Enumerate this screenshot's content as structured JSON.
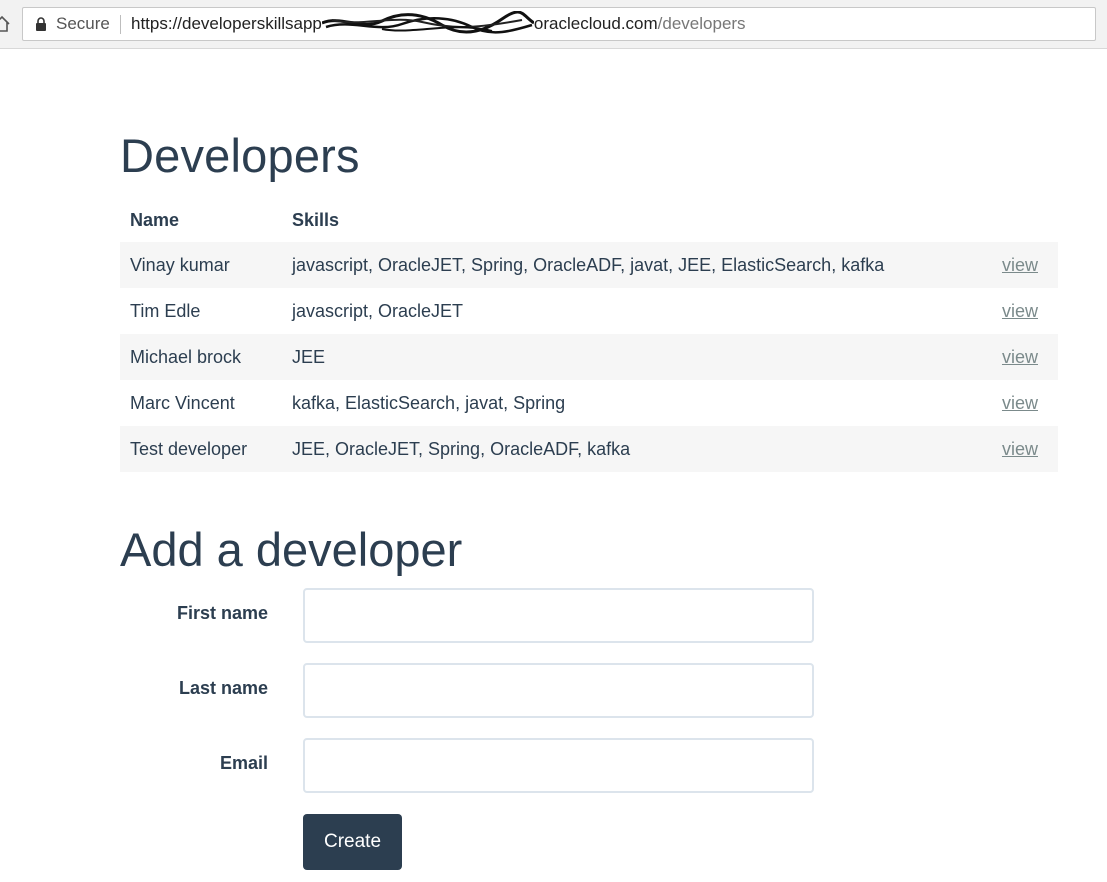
{
  "browser": {
    "secure_label": "Secure",
    "url_host_start": "https://developerskillsapp",
    "url_host_end": "oraclecloud.com",
    "url_path": "/developers"
  },
  "developers": {
    "title": "Developers",
    "columns": {
      "name": "Name",
      "skills": "Skills"
    },
    "rows": [
      {
        "name": "Vinay kumar",
        "skills": "javascript, OracleJET, Spring, OracleADF, javat, JEE, ElasticSearch, kafka",
        "link": "view"
      },
      {
        "name": "Tim Edle",
        "skills": "javascript, OracleJET",
        "link": "view"
      },
      {
        "name": "Michael brock",
        "skills": "JEE",
        "link": "view"
      },
      {
        "name": "Marc Vincent",
        "skills": "kafka, ElasticSearch, javat, Spring",
        "link": "view"
      },
      {
        "name": "Test developer",
        "skills": "JEE, OracleJET, Spring, OracleADF, kafka",
        "link": "view"
      }
    ]
  },
  "add_form": {
    "title": "Add a developer",
    "first_name": {
      "label": "First name",
      "value": ""
    },
    "last_name": {
      "label": "Last name",
      "value": ""
    },
    "email": {
      "label": "Email",
      "value": ""
    },
    "submit_label": "Create"
  },
  "colors": {
    "primary": "#2c3e50",
    "link": "#7b8a8b",
    "stripe": "#f6f6f6",
    "input_border": "#dce4ec"
  },
  "icons": [
    "home-icon",
    "lock-icon"
  ]
}
